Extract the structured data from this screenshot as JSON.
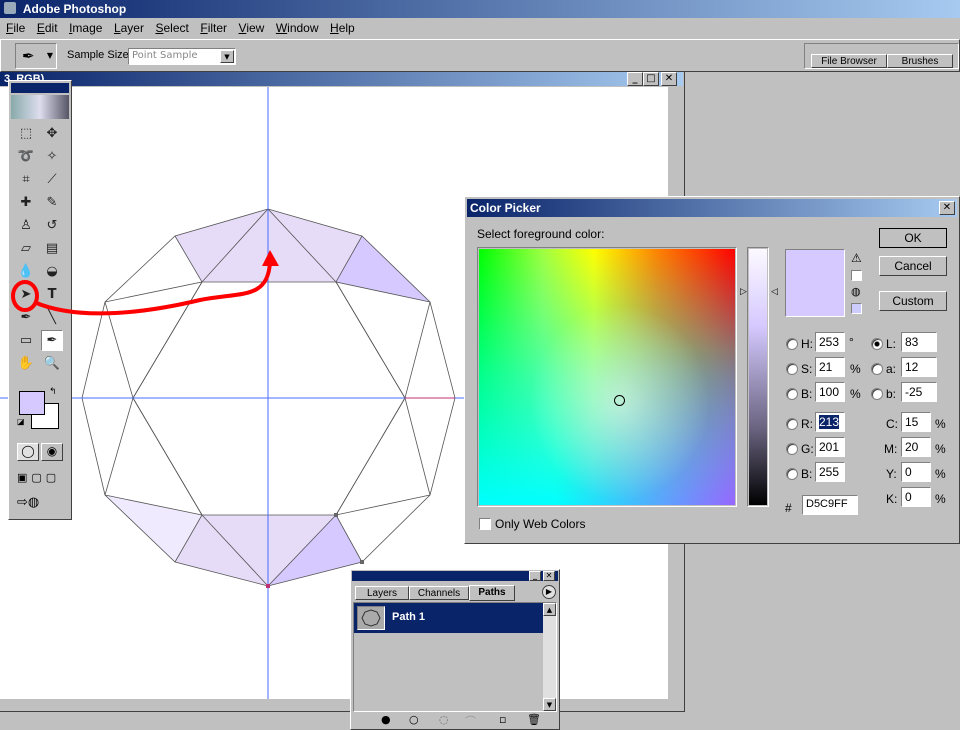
{
  "app": {
    "title": "Adobe Photoshop"
  },
  "menu": [
    "File",
    "Edit",
    "Image",
    "Layer",
    "Select",
    "Filter",
    "View",
    "Window",
    "Help"
  ],
  "options_bar": {
    "sample_size_label": "Sample Size:",
    "sample_size_value": "Point Sample"
  },
  "palette_well": {
    "tabs": [
      "File Browser",
      "Brushes"
    ]
  },
  "document": {
    "title": "3, RGB)"
  },
  "color_picker": {
    "title": "Color Picker",
    "prompt": "Select foreground color:",
    "ok": "OK",
    "cancel": "Cancel",
    "custom": "Custom",
    "hsb": {
      "h_label": "H:",
      "h": "253",
      "h_unit": "°",
      "s_label": "S:",
      "s": "21",
      "s_unit": "%",
      "b_label": "B:",
      "b": "100",
      "b_unit": "%"
    },
    "rgb": {
      "r_label": "R:",
      "r": "213",
      "g_label": "G:",
      "g": "201",
      "b_label": "B:",
      "b": "255"
    },
    "lab": {
      "l_label": "L:",
      "l": "83",
      "a_label": "a:",
      "a": "12",
      "b_label": "b:",
      "b": "-25"
    },
    "cmyk": {
      "c_label": "C:",
      "c": "15",
      "m_label": "M:",
      "m": "20",
      "y_label": "Y:",
      "y": "0",
      "k_label": "K:",
      "k": "0",
      "unit": "%"
    },
    "hex_label": "#",
    "hex": "D5C9FF",
    "only_web_label": "Only Web Colors",
    "selected_color": "#d5c9ff"
  },
  "paths_palette": {
    "tabs": [
      "Layers",
      "Channels",
      "Paths"
    ],
    "active_tab": "Paths",
    "paths": [
      "Path 1"
    ]
  },
  "colors": {
    "foreground": "#d5c9ff",
    "background": "#ffffff",
    "guide": "#4a6cff",
    "annotation": "#ff0000",
    "title_start": "#0a246a"
  }
}
